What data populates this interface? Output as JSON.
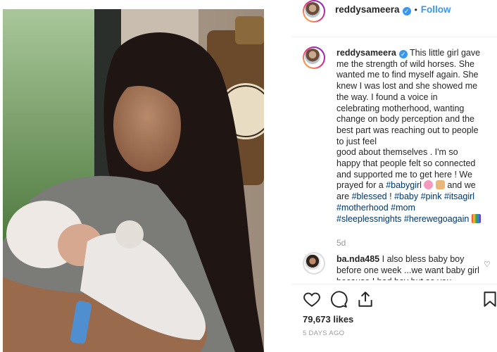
{
  "post": {
    "username": "reddysameera",
    "follow_label": "Follow",
    "separator": "•",
    "caption_lines": [
      "This little girl gave",
      "me the strength of wild horses. She",
      "wanted me to find myself again. She",
      "knew I was lost and she showed me",
      "the way. I found a voice in",
      "celebrating motherhood, wanting",
      "change on body perception and the",
      "best part was reaching out to people",
      "to just feel",
      "good about themselves . I'm so",
      "happy that people felt so connected",
      "and supported me to get here ! We",
      "prayed for a"
    ],
    "hashtags": {
      "babygirl": "#babygirl",
      "blessed": "#blessed",
      "baby": "#baby",
      "pink": "#pink",
      "itsagirl": "#itsagirl",
      "motherhood": "#motherhood",
      "mom": "#mom",
      "sleeplessnights": "#sleeplessnights",
      "herewegoagain": "#herewegoagain"
    },
    "and_we_are": "and we",
    "are": "are",
    "bang": "!",
    "time_ago": "5d",
    "likes": "79,673 likes",
    "date": "5 DAYS AGO"
  },
  "comment": {
    "username": "ba.nda485",
    "text": "I also bless baby boy before one week ...we want baby girl because I had boy but so you"
  },
  "colors": {
    "link": "#3897f0",
    "hashtag": "#003569",
    "muted": "#999999"
  },
  "icons": [
    "heart-icon",
    "comment-icon",
    "share-icon",
    "bookmark-icon",
    "verified-icon"
  ]
}
